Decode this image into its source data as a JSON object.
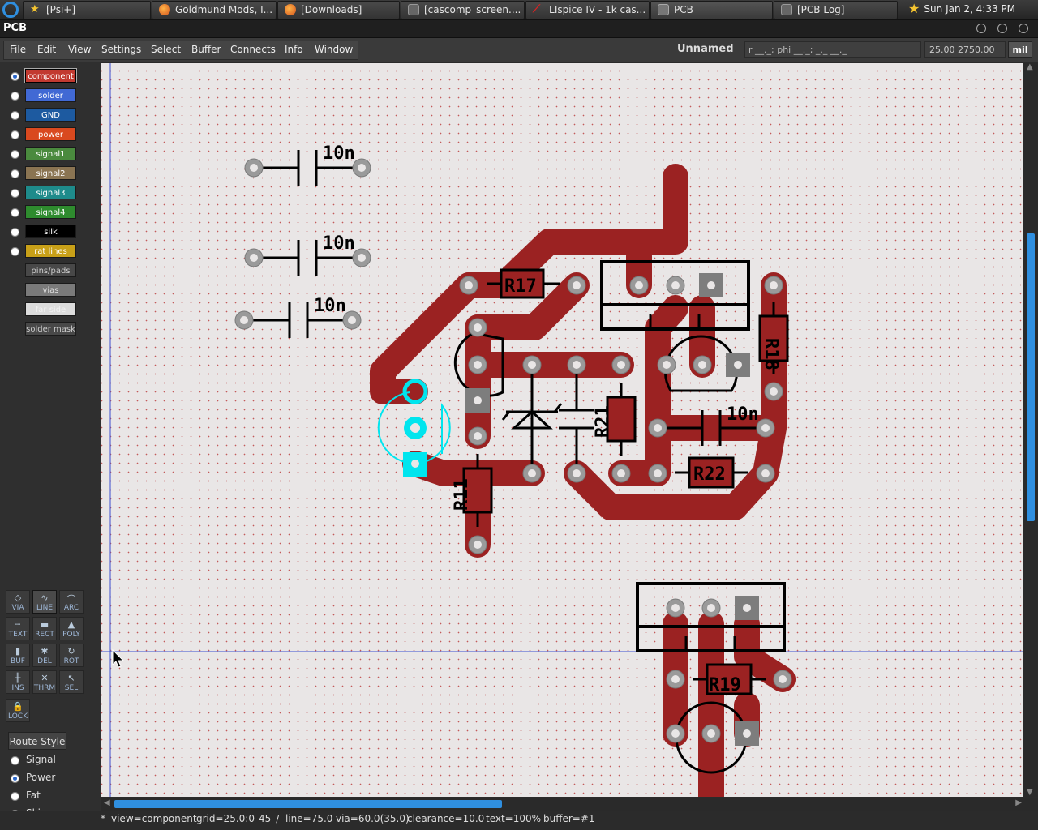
{
  "taskbar": {
    "tasks": [
      {
        "label": "[Psi+]",
        "icon": "star-icon"
      },
      {
        "label": "Goldmund Mods, I...",
        "icon": "firefox-icon"
      },
      {
        "label": "[Downloads]",
        "icon": "firefox-icon"
      },
      {
        "label": "[cascomp_screen....",
        "icon": "window-icon"
      },
      {
        "label": "LTspice IV - 1k cas...",
        "icon": "ltspice-icon"
      },
      {
        "label": "PCB",
        "icon": "window-icon"
      },
      {
        "label": "[PCB Log]",
        "icon": "window-icon"
      }
    ],
    "clock": "Sun Jan  2,  4:33 PM"
  },
  "window": {
    "title": "PCB"
  },
  "menu": {
    "items": [
      "File",
      "Edit",
      "View",
      "Settings",
      "Select",
      "Buffer",
      "Connects",
      "Info",
      "Window"
    ],
    "doc_name": "Unnamed",
    "coord_readout": "r __._; phi __._; _._ __._",
    "xy_readout": "25.00 2750.00",
    "units": "mil"
  },
  "layers": [
    {
      "label": "component",
      "color": "#c23a30",
      "selected": true,
      "radio": true
    },
    {
      "label": "solder",
      "color": "#4169d4",
      "radio": true
    },
    {
      "label": "GND",
      "color": "#1d5aa0",
      "radio": true
    },
    {
      "label": "power",
      "color": "#d9491f",
      "radio": true
    },
    {
      "label": "signal1",
      "color": "#4a8a3e",
      "radio": true
    },
    {
      "label": "signal2",
      "color": "#8a7452",
      "radio": true
    },
    {
      "label": "signal3",
      "color": "#1e8b8b",
      "radio": true
    },
    {
      "label": "signal4",
      "color": "#2e8b2e",
      "radio": true
    },
    {
      "label": "silk",
      "color": "#000000",
      "radio": true
    },
    {
      "label": "rat lines",
      "color": "#c8a018",
      "radio": true
    },
    {
      "label": "pins/pads",
      "color": "#484848",
      "radio": false
    },
    {
      "label": "vias",
      "color": "#7a7a7a",
      "radio": false
    },
    {
      "label": "far side",
      "color": "#dcdcdc",
      "radio": false
    },
    {
      "label": "solder mask",
      "color": "#484848",
      "radio": false
    }
  ],
  "tools": [
    {
      "label": "VIA",
      "glyph": "◇"
    },
    {
      "label": "LINE",
      "glyph": "∿"
    },
    {
      "label": "ARC",
      "glyph": "⌒"
    },
    {
      "label": "TEXT",
      "glyph": "┄"
    },
    {
      "label": "RECT",
      "glyph": "▬"
    },
    {
      "label": "POLY",
      "glyph": "▲"
    },
    {
      "label": "BUF",
      "glyph": "▮"
    },
    {
      "label": "DEL",
      "glyph": "✱"
    },
    {
      "label": "ROT",
      "glyph": "↻"
    },
    {
      "label": "INS",
      "glyph": "╫"
    },
    {
      "label": "THRM",
      "glyph": "✕"
    },
    {
      "label": "SEL",
      "glyph": "↖"
    },
    {
      "label": "LOCK",
      "glyph": "🔒"
    }
  ],
  "route_style": {
    "button_label": "Route Style",
    "options": [
      "Signal",
      "Power",
      "Fat",
      "Skinny"
    ],
    "selected": "Power"
  },
  "board": {
    "labels": [
      "10n",
      "10n",
      "10n",
      "R17",
      "R18",
      "R21",
      "10n",
      "R22",
      "R11",
      "R19"
    ],
    "colors": {
      "trace": "#9b2222",
      "silk": "#000000",
      "selected": "#00e5ee",
      "pad": "#9a9a9a",
      "background": "#e9e6e6"
    }
  },
  "status": {
    "prefix": "*",
    "view": "view=component",
    "grid": "grid=25.0:0",
    "angle": "45_/",
    "line": "line=75.0",
    "via": "via=60.0(35.0)",
    "clearance": "clearance=10.0",
    "text": "text=100%",
    "buffer": "buffer=#1"
  }
}
